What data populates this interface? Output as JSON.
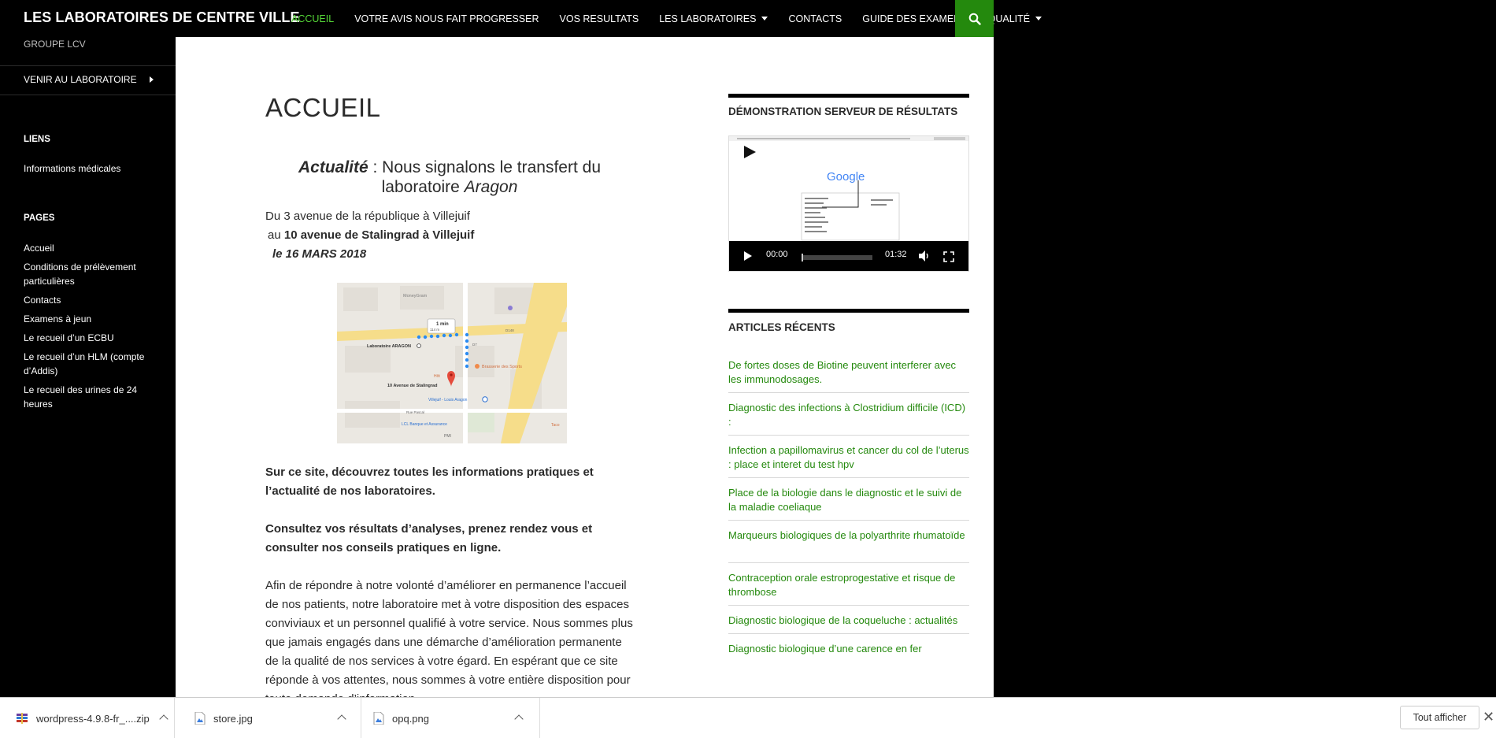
{
  "header": {
    "site_title": "LES LABORATOIRES DE CENTRE VILLE",
    "nav": [
      {
        "label": "ACCUEIL",
        "active": true,
        "has_submenu": false
      },
      {
        "label": "VOTRE AVIS NOUS FAIT PROGRESSER",
        "active": false,
        "has_submenu": false
      },
      {
        "label": "VOS RESULTATS",
        "active": false,
        "has_submenu": false
      },
      {
        "label": "LES LABORATOIRES",
        "active": false,
        "has_submenu": true
      },
      {
        "label": "CONTACTS",
        "active": false,
        "has_submenu": false
      },
      {
        "label": "GUIDE DES EXAMENS",
        "active": false,
        "has_submenu": false
      },
      {
        "label": "QUALITÉ",
        "active": false,
        "has_submenu": true
      }
    ],
    "search_icon": "search-icon"
  },
  "sidebar": {
    "description": "GROUPE LCV",
    "menu_item": "VENIR AU LABORATOIRE",
    "liens_heading": "LIENS",
    "liens": [
      "Informations médicales"
    ],
    "pages_heading": "PAGES",
    "pages": [
      "Accueil",
      "Conditions de prélèvement particulières",
      "Contacts",
      "Examens à jeun",
      "Le recueil d’un ECBU",
      "Le recueil d’un HLM (compte d’Addis)",
      "Le recueil des urines de 24 heures"
    ]
  },
  "main": {
    "page_title": "ACCUEIL",
    "news": {
      "prefix": "Actualité",
      "text1": " : Nous signalons le transfert du laboratoire ",
      "lab_name": "Aragon"
    },
    "addr_line1": "Du 3 avenue de la république à Villejuif",
    "addr_line2_prefix": "au ",
    "addr_line2_bold": "10 avenue de Stalingrad à Villejuif",
    "addr_line3": "le 16 MARS 2018",
    "map": {
      "label_1": "MoneyGram",
      "label_walk": "1 min",
      "label_walk_dist": "114 m",
      "label_lab": "Laboratoire ARAGON",
      "label_brasserie": "Brasserie des Sports",
      "label_dest": "10 Avenue de Stalingrad",
      "label_metro": "Villejuif - Louis Aragon",
      "label_bank": "LCL Banque et Assurance",
      "label_rue": "Rue Pascal",
      "label_road1": "D148",
      "label_road2": "D7",
      "label_pmi": "PMI",
      "label_hot": "Hôt",
      "label_tacos": "Taco"
    },
    "para1": "Sur ce site, découvrez toutes les informations pratiques et l’actualité de nos laboratoires.",
    "para2": "Consultez  vos résultats d’analyses, prenez rendez vous et consulter nos conseils pratiques en ligne.",
    "para3": "Afin de répondre à notre volonté d’améliorer en permanence l’accueil de nos patients, notre laboratoire met à votre disposition des espaces conviviaux et un personnel qualifié à votre service. Nous sommes plus que jamais engagés dans une démarche d’amélioration permanente de la qualité de nos services à votre égard. En espérant que ce site réponde à vos attentes, nous sommes à votre entière disposition pour toute demande d’information."
  },
  "widgets": {
    "demo_title": "DÉMONSTRATION SERVEUR DE RÉSULTATS",
    "video": {
      "current_time": "00:00",
      "duration": "01:32",
      "thumb_logo": "Google"
    },
    "recent_title": "ARTICLES RÉCENTS",
    "articles": [
      "De fortes doses de Biotine peuvent interferer avec les immunodosages.",
      "Diagnostic des infections à Clostridium difficile (ICD) :",
      "Infection a papillomavirus et cancer du col de l’uterus : place et interet du test hpv",
      "Place de la biologie dans le diagnostic et le suivi de la maladie coeliaque",
      "Marqueurs biologiques de la polyarthrite rhumatoïde",
      "Contraception orale estroprogestative et risque de thrombose",
      "Diagnostic biologique de la coqueluche : actualités",
      "Diagnostic biologique d’une carence en fer"
    ]
  },
  "downloads": {
    "items": [
      {
        "name": "wordpress-4.9.8-fr_....zip",
        "icon": "archive-icon"
      },
      {
        "name": "store.jpg",
        "icon": "image-file-icon"
      },
      {
        "name": "opq.png",
        "icon": "image-file-icon"
      }
    ],
    "show_all": "Tout afficher"
  },
  "colors": {
    "accent": "#24890d",
    "active_nav": "#55d737",
    "link": "#24890d"
  }
}
